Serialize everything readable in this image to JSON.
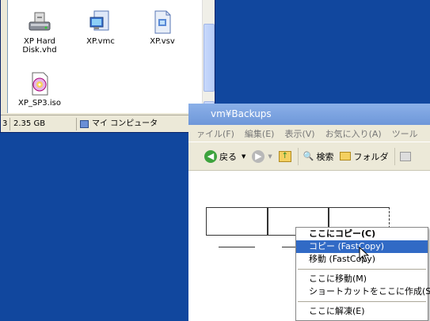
{
  "window1": {
    "files": [
      {
        "name": "XP Hard Disk.vhd",
        "line1": "XP Hard",
        "line2": "Disk.vhd",
        "icon": "hard-disk-icon"
      },
      {
        "name": "XP.vmc",
        "icon": "virtual-pc-config-icon"
      },
      {
        "name": "XP.vsv",
        "icon": "saved-state-icon"
      },
      {
        "name": "XP_SP3.iso",
        "icon": "iso-disc-icon"
      }
    ],
    "status": {
      "left": "3",
      "size": "2.35 GB",
      "location": "マイ コンピュータ"
    }
  },
  "window2": {
    "title": "vm¥Backups",
    "menu": [
      "ァイル(F)",
      "編集(E)",
      "表示(V)",
      "お気に入り(A)",
      "ツール"
    ],
    "toolbar": {
      "back": "戻る",
      "search": "検索",
      "folders": "フォルダ"
    }
  },
  "context_menu": {
    "items": [
      {
        "label": "ここにコピー(C)",
        "bold": true
      },
      {
        "label": "コピー (FastCopy)",
        "highlighted": true
      },
      {
        "label": "移動 (FastCopy)"
      },
      {
        "label": "ここに移動(M)"
      },
      {
        "label": "ショートカットをここに作成(S)"
      },
      {
        "label": "ここに解凍(E)"
      }
    ]
  }
}
